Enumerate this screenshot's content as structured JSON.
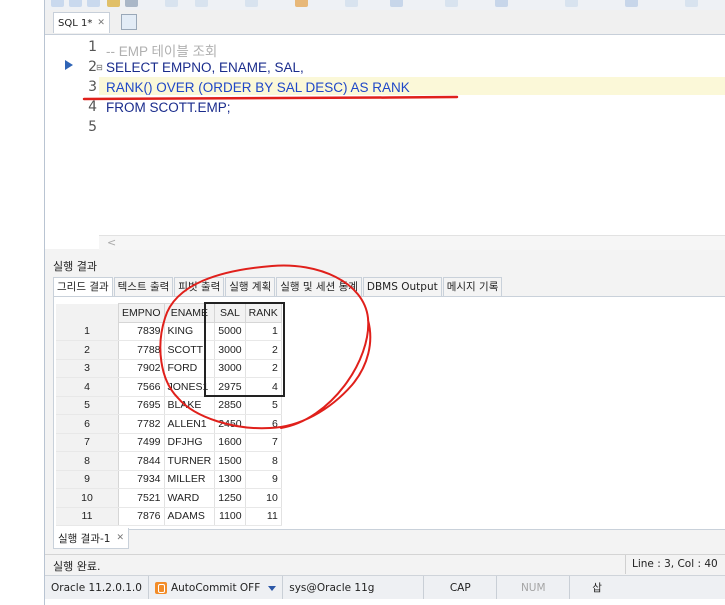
{
  "editor_tab": {
    "label": "SQL 1*",
    "close": "✕"
  },
  "editor": {
    "lines": [
      {
        "n": "1",
        "text": "-- EMP 테이블 조회"
      },
      {
        "n": "2",
        "text": "SELECT EMPNO, ENAME, SAL,"
      },
      {
        "n": "3",
        "text": "RANK() OVER (ORDER BY SAL DESC) AS RANK"
      },
      {
        "n": "4",
        "text": "FROM SCOTT.EMP;"
      },
      {
        "n": "5",
        "text": ""
      }
    ],
    "scroll_arrow": "<"
  },
  "result_panel": {
    "title": "실행 결과",
    "tabs": [
      "그리드 결과",
      "텍스트 출력",
      "피벗 출력",
      "실행 계획",
      "실행 및 세션 통계",
      "DBMS Output",
      "메시지 기록"
    ]
  },
  "grid": {
    "columns": [
      "EMPNO",
      "ENAME",
      "SAL",
      "RANK"
    ],
    "rows": [
      {
        "n": "1",
        "empno": "7839",
        "ename": "KING",
        "sal": "5000",
        "rank": "1"
      },
      {
        "n": "2",
        "empno": "7788",
        "ename": "SCOTT",
        "sal": "3000",
        "rank": "2"
      },
      {
        "n": "3",
        "empno": "7902",
        "ename": "FORD",
        "sal": "3000",
        "rank": "2"
      },
      {
        "n": "4",
        "empno": "7566",
        "ename": "JONES1",
        "sal": "2975",
        "rank": "4"
      },
      {
        "n": "5",
        "empno": "7695",
        "ename": "BLAKE",
        "sal": "2850",
        "rank": "5"
      },
      {
        "n": "6",
        "empno": "7782",
        "ename": "ALLEN1",
        "sal": "2450",
        "rank": "6"
      },
      {
        "n": "7",
        "empno": "7499",
        "ename": "DFJHG",
        "sal": "1600",
        "rank": "7"
      },
      {
        "n": "8",
        "empno": "7844",
        "ename": "TURNER",
        "sal": "1500",
        "rank": "8"
      },
      {
        "n": "9",
        "empno": "7934",
        "ename": "MILLER",
        "sal": "1300",
        "rank": "9"
      },
      {
        "n": "10",
        "empno": "7521",
        "ename": "WARD",
        "sal": "1250",
        "rank": "10"
      },
      {
        "n": "11",
        "empno": "7876",
        "ename": "ADAMS",
        "sal": "1100",
        "rank": "11"
      }
    ]
  },
  "bottom_tab": {
    "label": "실행 결과-1",
    "close": "✕"
  },
  "status": {
    "message": "실행 완료.",
    "position": "Line : 3, Col : 40",
    "db_version": "Oracle 11.2.0.1.0",
    "autocommit": "AutoCommit OFF",
    "connection": "sys@Oracle 11g",
    "cap": "CAP",
    "num": "NUM",
    "ins": "삽"
  },
  "colors": {
    "keyword": "#1a2c8c",
    "highlight_line": "#fbf8d8",
    "annotation_red": "#e0201b"
  }
}
